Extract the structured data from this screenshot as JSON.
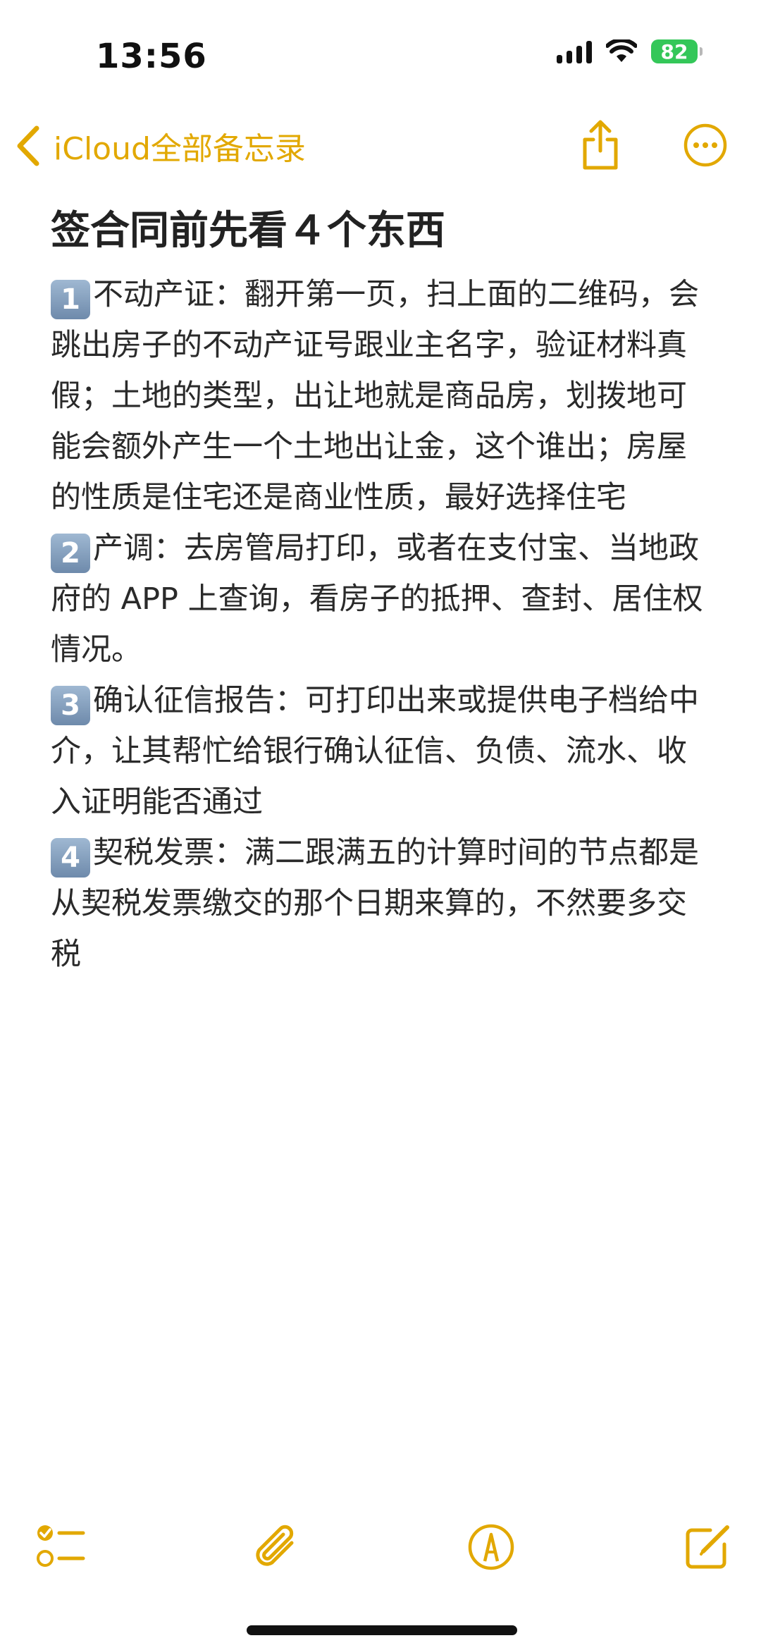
{
  "status_bar": {
    "time": "13:56",
    "battery_level": "82",
    "icons": [
      "signal-icon",
      "wifi-icon",
      "battery-charging-icon"
    ]
  },
  "nav": {
    "back_label": "iCloud全部备忘录",
    "icons": [
      "chevron-left-icon",
      "share-icon",
      "more-icon"
    ]
  },
  "note": {
    "title": "签合同前先看４个东西",
    "paragraphs": [
      {
        "badge": "1",
        "text": "不动产证：翻开第一页，扫上面的二维码，会跳出房子的不动产证号跟业主名字，验证材料真假；土地的类型，出让地就是商品房，划拨地可能会额外产生一个土地出让金，这个谁出；房屋的性质是住宅还是商业性质，最好选择住宅"
      },
      {
        "badge": "2",
        "text": "产调：去房管局打印，或者在支付宝、当地政府的 APP 上查询，看房子的抵押、查封、居住权情况。"
      },
      {
        "badge": "3",
        "text": "确认征信报告：可打印出来或提供电子档给中介，让其帮忙给银行确认征信、负债、流水、收入证明能否通过"
      },
      {
        "badge": "4",
        "text": "契税发票：满二跟满五的计算时间的节点都是从契税发票缴交的那个日期来算的，不然要多交税"
      }
    ]
  },
  "toolbar": {
    "icons": [
      "checklist-icon",
      "paperclip-icon",
      "markup-pen-icon",
      "compose-icon"
    ]
  },
  "colors": {
    "accent": "#e2a800",
    "text": "#222222",
    "badge": "#7b94b3",
    "battery": "#34c759"
  }
}
